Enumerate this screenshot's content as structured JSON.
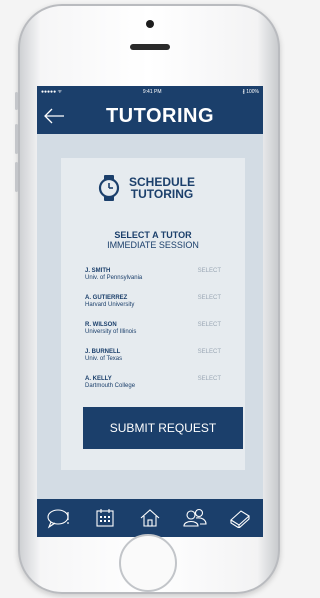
{
  "status_bar": {
    "signal": "●●●●● ᯤ",
    "time": "9:41 PM",
    "battery": "∦ 100%"
  },
  "header": {
    "title": "TUTORING"
  },
  "schedule": {
    "line1": "SCHEDULE",
    "line2": "TUTORING"
  },
  "select": {
    "title": "SELECT A TUTOR",
    "subtitle": "IMMEDIATE SESSION"
  },
  "tutors": [
    {
      "name": "J. SMITH",
      "school": "Univ. of Pennsylvania",
      "action": "SELECT"
    },
    {
      "name": "A. GUTIERREZ",
      "school": "Harvard University",
      "action": "SELECT"
    },
    {
      "name": "R. WILSON",
      "school": "University of Illinois",
      "action": "SELECT"
    },
    {
      "name": "J. BURNELL",
      "school": "Univ. of Texas",
      "action": "SELECT"
    },
    {
      "name": "A. KELLY",
      "school": "Dartmouth College",
      "action": "SELECT"
    }
  ],
  "submit": {
    "label": "SUBMIT REQUEST"
  },
  "tabs": [
    "chat-icon",
    "calendar-icon",
    "home-icon",
    "people-icon",
    "book-icon"
  ],
  "colors": {
    "brand": "#1b3f6b",
    "background": "#d3dce4",
    "card": "#e6ebef",
    "muted": "#9aa7b4"
  }
}
